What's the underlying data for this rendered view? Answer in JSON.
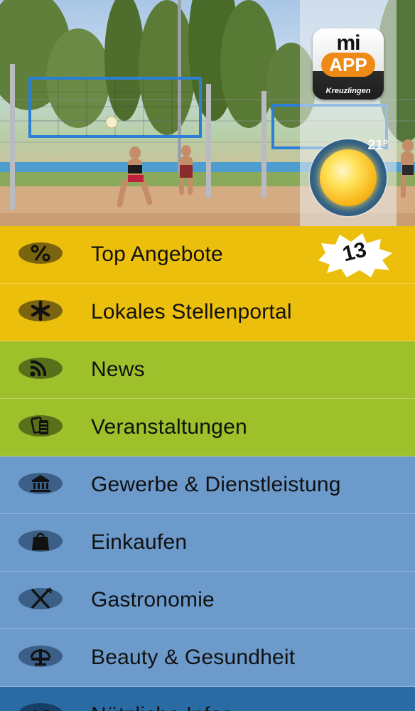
{
  "header": {
    "logo": {
      "top_text": "mi",
      "badge_text": "APP",
      "city": "Kreuzlingen"
    },
    "weather": {
      "temperature": "21°",
      "icon": "sun-icon"
    }
  },
  "menu": {
    "items": [
      {
        "label": "Top Angebote",
        "icon": "percent-icon",
        "badge": "13",
        "color": "#ecbf0c"
      },
      {
        "label": "Lokales Stellenportal",
        "icon": "asterisk-icon",
        "color": "#ecbf0c"
      },
      {
        "label": "News",
        "icon": "rss-icon",
        "color": "#9ec12b"
      },
      {
        "label": "Veranstaltungen",
        "icon": "tickets-icon",
        "color": "#9ec12b"
      },
      {
        "label": "Gewerbe & Dienstleistung",
        "icon": "building-icon",
        "color": "#6c9acb"
      },
      {
        "label": "Einkaufen",
        "icon": "shopping-bag-icon",
        "color": "#6c9acb"
      },
      {
        "label": "Gastronomie",
        "icon": "cutlery-icon",
        "color": "#6c9acb"
      },
      {
        "label": "Beauty & Gesundheit",
        "icon": "fountain-icon",
        "color": "#6c9acb"
      },
      {
        "label": "Nützliche Infos",
        "icon": "az-icon",
        "color": "#2a6ba4"
      }
    ]
  }
}
